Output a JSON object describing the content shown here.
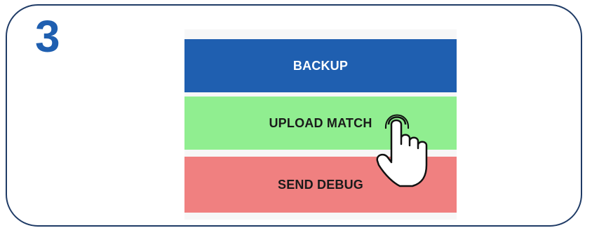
{
  "step": {
    "number": "3"
  },
  "buttons": {
    "backup": "BACKUP",
    "upload_match": "UPLOAD MATCH",
    "send_debug": "SEND DEBUG"
  },
  "colors": {
    "frame": "#1f3b66",
    "step_number": "#1f5fb0",
    "backup_bg": "#1f5fb0",
    "upload_bg": "#90ee90",
    "debug_bg": "#f08080"
  },
  "icons": {
    "pointer": "tap-hand-icon"
  }
}
